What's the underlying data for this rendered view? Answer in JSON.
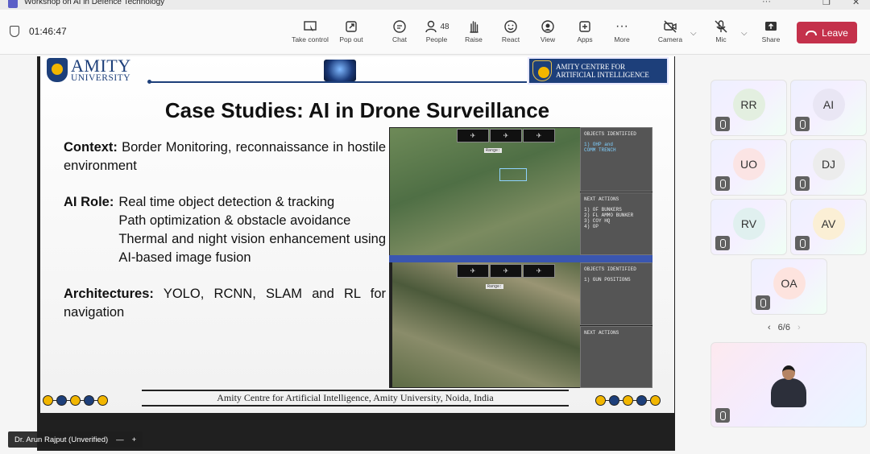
{
  "window": {
    "title": "Workshop on AI in Defence Technology",
    "min": "···",
    "restore": "❐",
    "close": "✕"
  },
  "meeting": {
    "elapsed": "01:46:47"
  },
  "toolbar": {
    "take_control": "Take control",
    "pop_out": "Pop out",
    "chat": "Chat",
    "people": "People",
    "people_count": "48",
    "raise": "Raise",
    "react": "React",
    "view": "View",
    "apps": "Apps",
    "more": "More",
    "camera": "Camera",
    "mic": "Mic",
    "share": "Share",
    "leave": "Leave"
  },
  "slide": {
    "brand_line1": "AMITY",
    "brand_line2": "UNIVERSITY",
    "centre_line1": "AMITY CENTRE FOR",
    "centre_line2": "ARTIFICIAL INTELLIGENCE",
    "title": "Case Studies: AI in Drone Surveillance",
    "context_label": "Context:",
    "context_text": "Border Monitoring, reconnaissance in hostile environment",
    "ai_role_label": "AI Role:",
    "ai_role_1": "Real time object detection & tracking",
    "ai_role_2": "Path optimization & obstacle avoidance",
    "ai_role_3": "Thermal and night vision enhancement using AI-based image fusion",
    "arch_label": "Architectures:",
    "arch_text": "YOLO, RCNN, SLAM and RL for navigation",
    "footer": "Amity Centre for Artificial Intelligence, Amity University, Noida, India",
    "panel": {
      "objects_title_1": "OBJECTS IDENTIFIED",
      "objects_1a": "1) OHP and",
      "objects_1b": "COMM TRENCH",
      "next_title_1": "NEXT ACTIONS",
      "next_1": "1) OF BUNKERS",
      "next_2": "2) FL AMMO BUNKER",
      "next_3": "3) COY HQ",
      "next_4": "4) OP",
      "objects_title_2": "OBJECTS IDENTIFIED",
      "objects_2": "1) GUN POSITIONS",
      "next_title_2": "NEXT ACTIONS",
      "range_1": "Range:",
      "range_2": "Range:"
    }
  },
  "presenter": {
    "name": "Dr. Arun Rajput (Unverified)",
    "minus": "—",
    "plus": "+"
  },
  "participants": [
    {
      "initials": "RR",
      "color": "#e3efe0"
    },
    {
      "initials": "AI",
      "color": "#e9e6f4"
    },
    {
      "initials": "UO",
      "color": "#fbe4e4"
    },
    {
      "initials": "DJ",
      "color": "#ececec"
    },
    {
      "initials": "RV",
      "color": "#e0f0ef"
    },
    {
      "initials": "AV",
      "color": "#fbefd5"
    },
    {
      "initials": "OA",
      "color": "#fde3de"
    }
  ],
  "pager": {
    "prev": "‹",
    "label": "6/6",
    "next": "›"
  }
}
